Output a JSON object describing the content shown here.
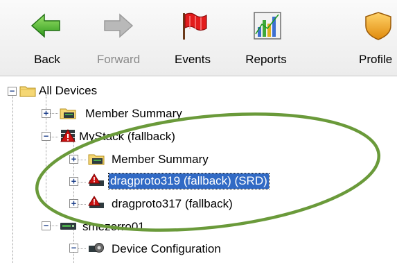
{
  "toolbar": {
    "buttons": [
      {
        "label": "Back",
        "icon": "back-arrow-icon",
        "enabled": true
      },
      {
        "label": "Forward",
        "icon": "forward-arrow-icon",
        "enabled": false
      },
      {
        "label": "Events",
        "icon": "flag-icon",
        "enabled": true
      },
      {
        "label": "Reports",
        "icon": "bar-chart-icon",
        "enabled": true
      },
      {
        "label": "Profile",
        "icon": "shield-icon",
        "enabled": true
      }
    ]
  },
  "tree": {
    "nodes": [
      {
        "label": "All Devices",
        "icon": "folder-icon",
        "expanded": true
      },
      {
        "label": "Member Summary",
        "icon": "member-summary-folder-icon",
        "expanded": false
      },
      {
        "label": "MyStack (fallback)",
        "icon": "stack-alert-icon",
        "expanded": true
      },
      {
        "label": "Member Summary",
        "icon": "member-summary-folder-icon",
        "expanded": false
      },
      {
        "label": "dragproto319 (fallback) (SRD)",
        "icon": "device-alert-icon",
        "expanded": false,
        "selected": true
      },
      {
        "label": "dragproto317 (fallback)",
        "icon": "device-alert-icon",
        "expanded": false
      },
      {
        "label": "smezorro01",
        "icon": "switch-device-icon",
        "expanded": true
      },
      {
        "label": "Device Configuration",
        "icon": "device-configuration-icon",
        "expanded": false
      }
    ]
  },
  "colors": {
    "selection": "#316ac5",
    "annotation_ellipse": "#6a9a3a",
    "alert_red": "#cc1111"
  }
}
